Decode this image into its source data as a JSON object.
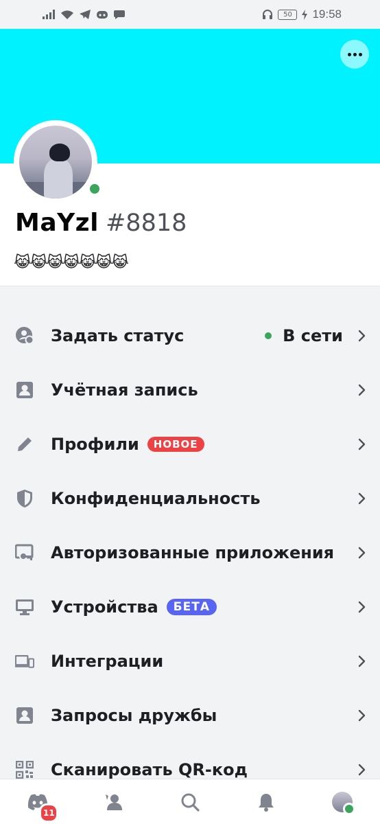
{
  "status_bar": {
    "time": "19:58",
    "battery": "50",
    "icons": [
      "signal-icon",
      "wifi-icon",
      "telegram-icon",
      "discord-icon",
      "chat-icon",
      "headphones-icon",
      "charging-icon"
    ]
  },
  "banner": {
    "color": "#00f1ff",
    "more_icon": "more-dots-icon"
  },
  "profile": {
    "username": "MaYzl",
    "tag": "#8818",
    "bio": "😹😹😹😹😹😹😹",
    "presence": "online",
    "presence_color": "#3ba55d"
  },
  "menu": {
    "items": [
      {
        "label": "Задать статус",
        "icon": "status-icon",
        "value": "В сети"
      },
      {
        "label": "Учётная запись",
        "icon": "account-icon"
      },
      {
        "label": "Профили",
        "icon": "pencil-icon",
        "badge": "НОВОЕ"
      },
      {
        "label": "Конфиденциальность",
        "icon": "shield-icon"
      },
      {
        "label": "Авторизованные приложения",
        "icon": "key-icon"
      },
      {
        "label": "Устройства",
        "icon": "monitor-icon",
        "badge": "БЕТА"
      },
      {
        "label": "Интеграции",
        "icon": "devices-icon"
      },
      {
        "label": "Запросы дружбы",
        "icon": "friend-requests-icon"
      },
      {
        "label": "Сканировать QR-код",
        "icon": "qr-code-icon"
      }
    ]
  },
  "bottom_nav": {
    "items": [
      {
        "name": "home",
        "icon": "discord-home-icon",
        "badge": "11"
      },
      {
        "name": "friends",
        "icon": "friends-icon"
      },
      {
        "name": "search",
        "icon": "search-icon"
      },
      {
        "name": "notifications",
        "icon": "bell-icon"
      },
      {
        "name": "profile",
        "icon": "avatar"
      }
    ]
  },
  "colors": {
    "accent_blurple": "#5865f2",
    "danger_red": "#ed4245",
    "online_green": "#3ba55d",
    "background": "#f2f3f5"
  }
}
